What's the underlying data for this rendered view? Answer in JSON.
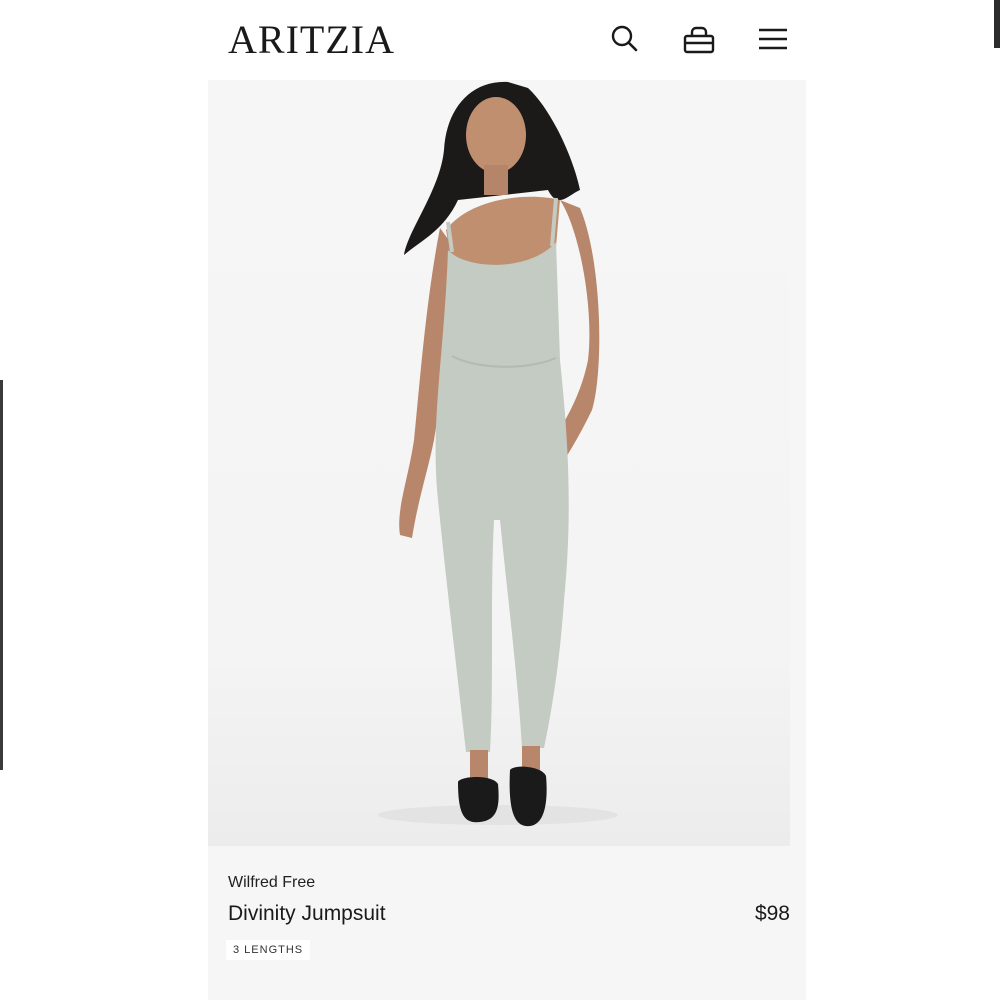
{
  "header": {
    "logo": "ARITZIA",
    "icons": [
      "search-icon",
      "shopping-bag-icon",
      "menu-icon"
    ]
  },
  "product": {
    "brand": "Wilfred Free",
    "name": "Divinity Jumpsuit",
    "price": "$98",
    "badge": "3 LENGTHS",
    "color": "#c3cbc2"
  }
}
